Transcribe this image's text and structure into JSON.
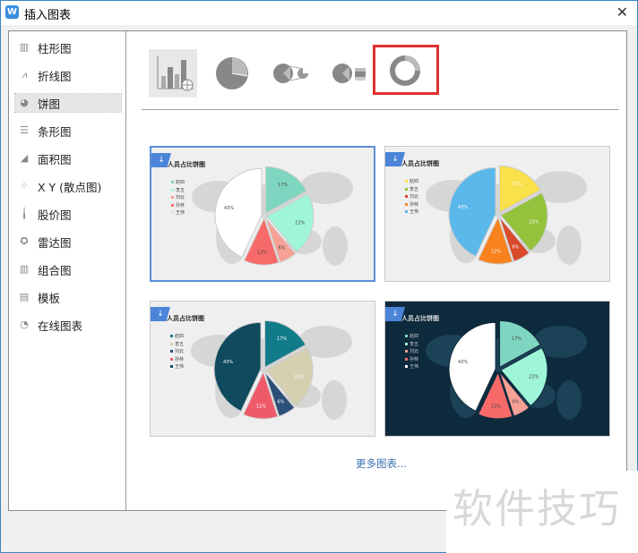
{
  "window": {
    "title": "插入图表",
    "app_icon": "W",
    "close_label": "✕"
  },
  "sidebar": {
    "items": [
      {
        "label": "柱形图",
        "icon": "bar-chart-icon",
        "glyph": "▥"
      },
      {
        "label": "折线图",
        "icon": "line-chart-icon",
        "glyph": "⩘"
      },
      {
        "label": "饼图",
        "icon": "pie-chart-icon",
        "glyph": "◕",
        "selected": true
      },
      {
        "label": "条形图",
        "icon": "horizontal-bar-icon",
        "glyph": "☰"
      },
      {
        "label": "面积图",
        "icon": "area-chart-icon",
        "glyph": "◢"
      },
      {
        "label": "X Y (散点图)",
        "icon": "scatter-icon",
        "glyph": "⁘"
      },
      {
        "label": "股价图",
        "icon": "stock-chart-icon",
        "glyph": "╽"
      },
      {
        "label": "雷达图",
        "icon": "radar-chart-icon",
        "glyph": "✪"
      },
      {
        "label": "组合图",
        "icon": "combo-chart-icon",
        "glyph": "▥"
      },
      {
        "label": "模板",
        "icon": "template-icon",
        "glyph": "▤"
      },
      {
        "label": "在线图表",
        "icon": "online-chart-icon",
        "glyph": "◔"
      }
    ]
  },
  "chart_types": [
    {
      "name": "pie-online-template",
      "selected": true
    },
    {
      "name": "pie"
    },
    {
      "name": "pie-of-pie"
    },
    {
      "name": "bar-of-pie"
    },
    {
      "name": "doughnut",
      "highlighted": true
    }
  ],
  "templates": {
    "title": "人员占比饼图",
    "legend": [
      "赵四",
      "李五",
      "刘云",
      "孙林",
      "王伟"
    ],
    "values": [
      17,
      22,
      6,
      12,
      43
    ],
    "labels": [
      "17%",
      "22%",
      "6%",
      "12%",
      "43%"
    ],
    "cards": [
      {
        "theme": "light",
        "selected": true,
        "colors": [
          "#7fd6c0",
          "#9ef5d8",
          "#f7a096",
          "#f86a6a",
          "#ffffff"
        ],
        "label_color": "#444"
      },
      {
        "theme": "light",
        "colors": [
          "#f9e14b",
          "#95c23c",
          "#d94a2b",
          "#f7821e",
          "#5ab8ea"
        ],
        "label_color": "#fff"
      },
      {
        "theme": "light",
        "colors": [
          "#117b8a",
          "#d5d1b0",
          "#2c4f7a",
          "#ef5a6a",
          "#0f4a5e"
        ],
        "label_color": "#fff"
      },
      {
        "theme": "dark",
        "colors": [
          "#7fd6c0",
          "#9ef5d8",
          "#f7a096",
          "#f86a6a",
          "#ffffff"
        ],
        "label_color": "#444"
      }
    ]
  },
  "more_link": "更多图表...",
  "watermark": "软件技巧"
}
